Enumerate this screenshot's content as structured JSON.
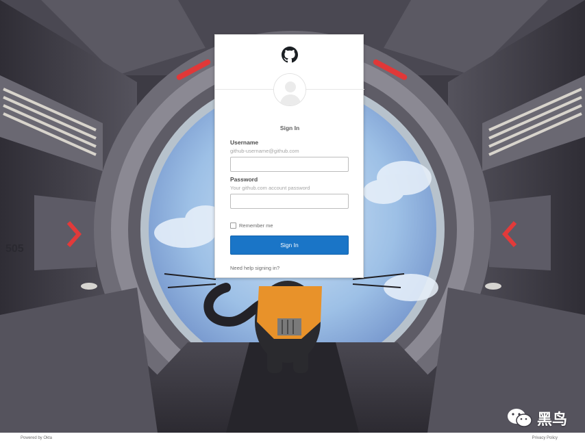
{
  "card": {
    "title": "Sign In",
    "username": {
      "label": "Username",
      "hint": "github-username@github.com",
      "value": ""
    },
    "password": {
      "label": "Password",
      "hint": "Your github.com account password",
      "value": ""
    },
    "remember_label": "Remember me",
    "signin_label": "Sign In",
    "help_link": "Need help signing in?"
  },
  "footer": {
    "powered_by": "Powered by Okta",
    "privacy": "Privacy Policy"
  },
  "watermark": {
    "text": "黑鸟"
  },
  "icons": {
    "logo": "github-octocat-icon",
    "avatar": "user-avatar-icon",
    "watermark": "wechat-icon"
  },
  "colors": {
    "primary_button": "#1a75c7",
    "card_background": "#ffffff"
  }
}
